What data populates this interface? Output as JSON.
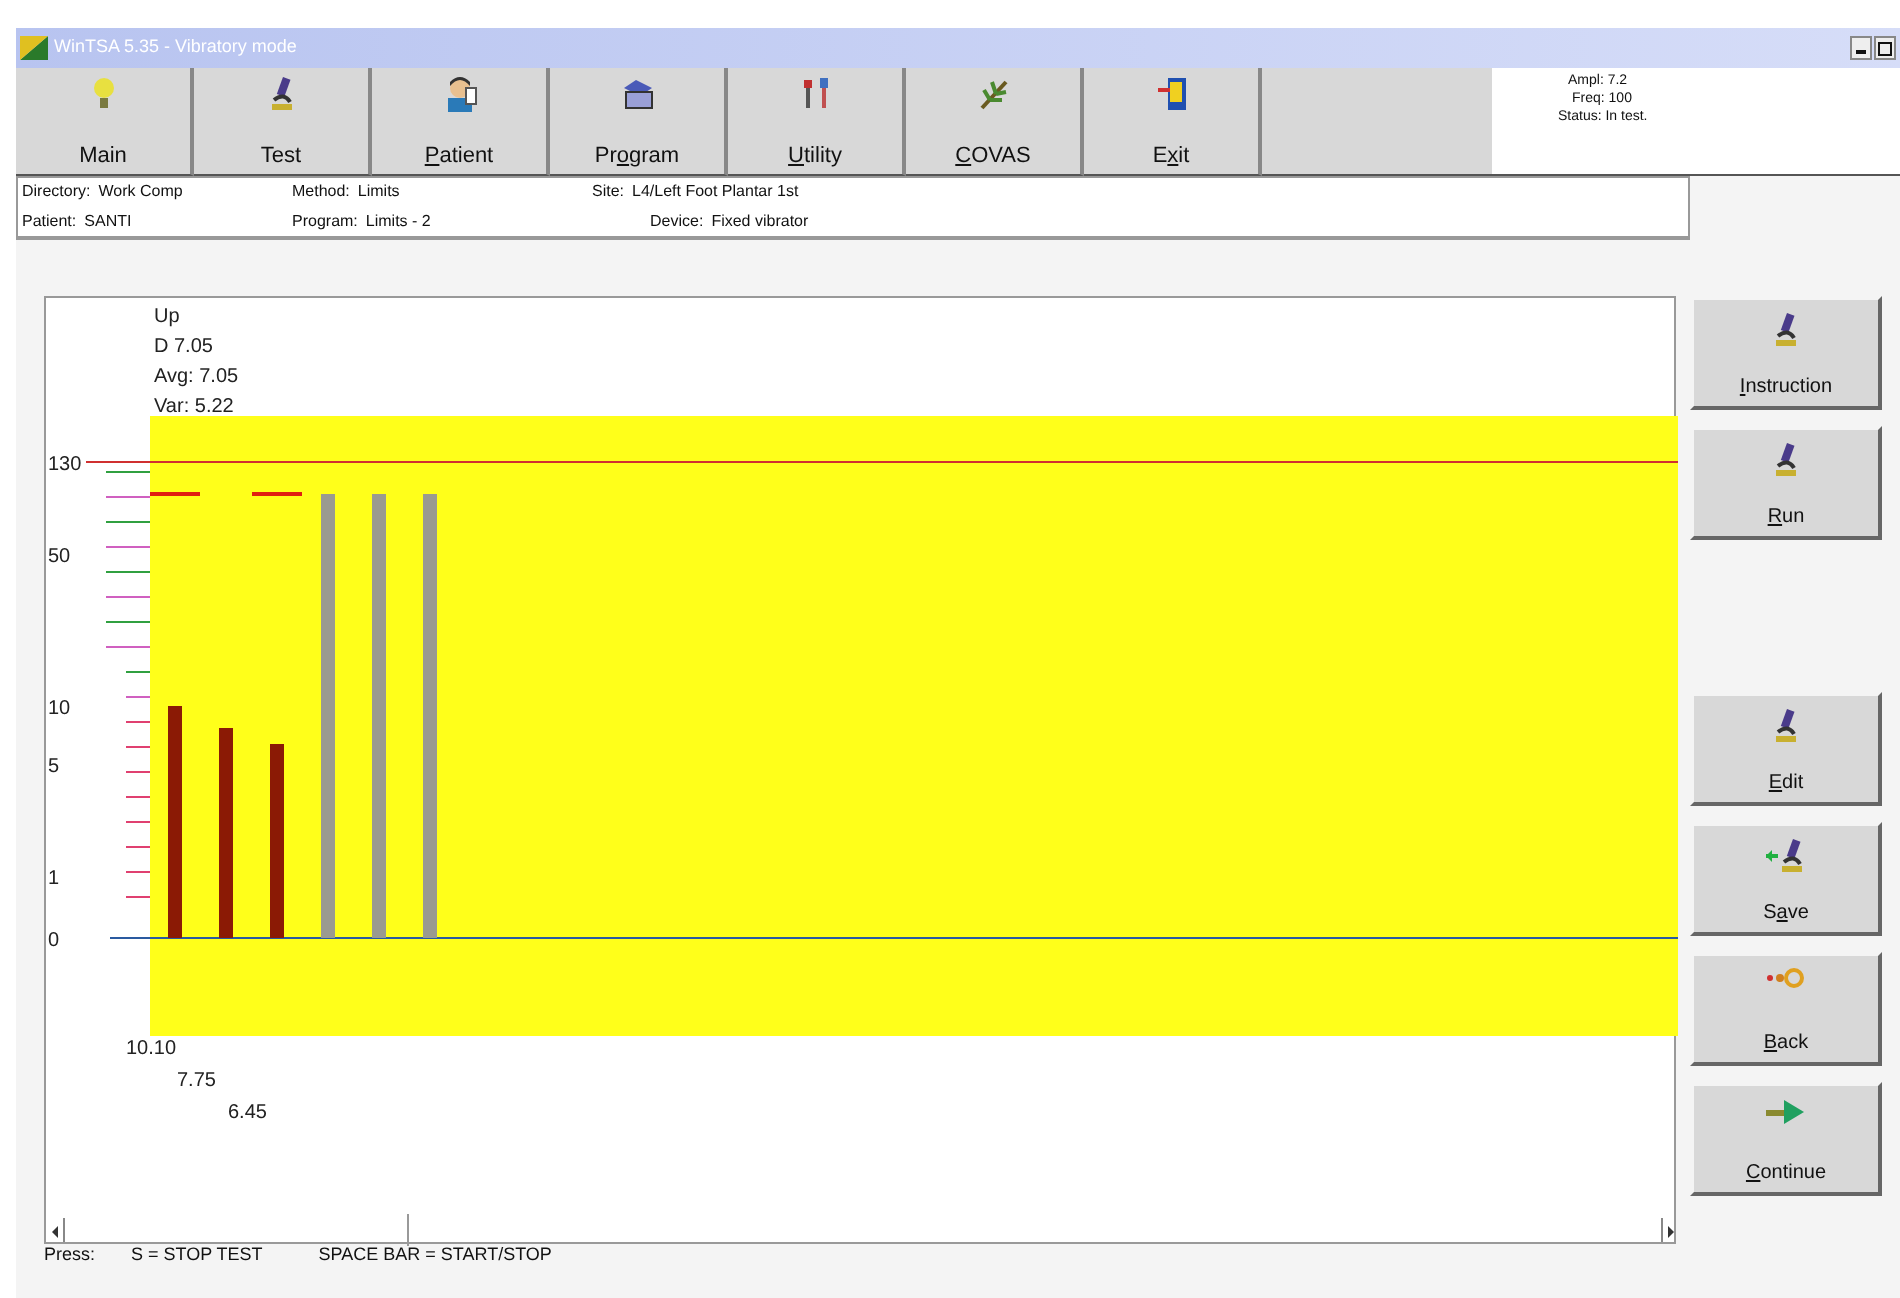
{
  "window": {
    "title": "WinTSA 5.35 - Vibratory mode"
  },
  "toolbar": [
    {
      "label": "Main"
    },
    {
      "label": "Test"
    },
    {
      "label": "Patient"
    },
    {
      "label": "Program"
    },
    {
      "label": "Utility"
    },
    {
      "label": "COVAS"
    },
    {
      "label": "Exit"
    }
  ],
  "status": [
    "Ampl: 7.2",
    "Freq: 100",
    "Status: In test."
  ],
  "info": [
    {
      "label": "Directory:",
      "value": "Work Comp"
    },
    {
      "label": "Patient:",
      "value": "SANTI"
    },
    {
      "label": "Method:",
      "value": "Limits"
    },
    {
      "label": "Program:",
      "value": "Limits - 2"
    },
    {
      "label": "Site:",
      "value": "L4/Left Foot Plantar 1st"
    },
    {
      "label": "Device:",
      "value": "Fixed vibrator"
    }
  ],
  "plot": {
    "stats": [
      "Up",
      "D 7.05",
      "Avg: 7.05",
      "Var: 5.22"
    ],
    "axis_labels": [
      "130",
      "50",
      "10",
      "5",
      "1",
      "0"
    ],
    "value_labels": [
      "10.10",
      "7.75",
      "6.45"
    ]
  },
  "side_buttons": [
    {
      "label": "Instruction"
    },
    {
      "label": "Run"
    },
    {
      "label": "Edit"
    },
    {
      "label": "Save"
    },
    {
      "label": "Back"
    },
    {
      "label": "Continue"
    }
  ],
  "footer": [
    "Press:",
    "S = STOP TEST",
    "SPACE BAR = START/STOP"
  ]
}
